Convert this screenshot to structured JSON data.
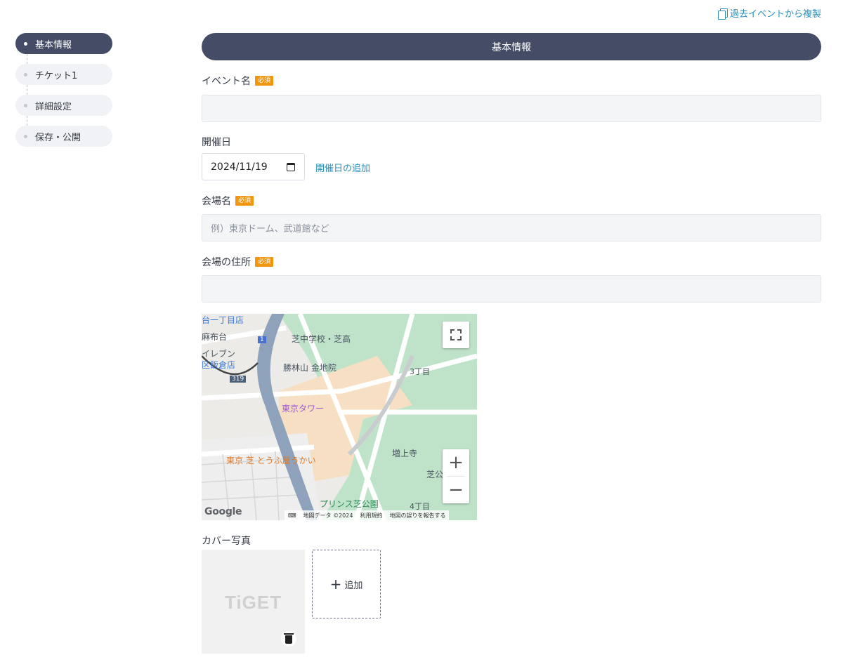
{
  "top_link": {
    "label": "過去イベントから複製",
    "icon": "copy-icon"
  },
  "steps": [
    {
      "label": "基本情報",
      "active": true
    },
    {
      "label": "チケット1",
      "active": false
    },
    {
      "label": "詳細設定",
      "active": false
    },
    {
      "label": "保存・公開",
      "active": false
    }
  ],
  "section": {
    "title": "基本情報"
  },
  "form": {
    "required_badge": "必須",
    "event_name": {
      "label": "イベント名",
      "value": "",
      "placeholder": ""
    },
    "date": {
      "label": "開催日",
      "value": "2024/11/19",
      "add_label": "開催日の追加"
    },
    "venue": {
      "label": "会場名",
      "placeholder": "例）東京ドーム、武道館など"
    },
    "address": {
      "label": "会場の住所",
      "value": ""
    }
  },
  "map": {
    "labels": {
      "l1": "台一丁目店",
      "l2": "麻布台",
      "l3": "芝中学校・芝高",
      "l4": "イレブン",
      "l5": "区飯倉店",
      "l6": "勝林山 金地院",
      "l7": "3丁目",
      "l8": "東京タワー",
      "l9": "増上寺",
      "l10": "東京 芝 とうふ屋うかい",
      "l11": "芝公",
      "l12": "プリンス芝公園",
      "l13": "4丁目",
      "l14": "319",
      "l15": "1"
    },
    "zoom_in": "+",
    "zoom_out": "−",
    "google": "Google",
    "footer": {
      "data": "地図データ ©2024",
      "terms": "利用規約",
      "report": "地図の誤りを報告する"
    }
  },
  "cover": {
    "label": "カバー写真",
    "logo_text": "TiGET",
    "add_label": "追加"
  },
  "colors": {
    "accent": "#444c66",
    "link": "#2b8fbd",
    "required": "#f0960f"
  }
}
